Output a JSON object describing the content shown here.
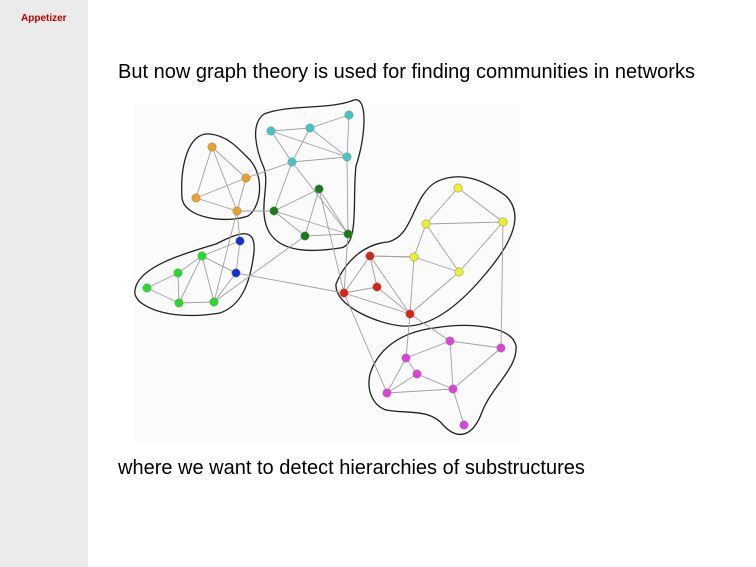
{
  "sidebar": {
    "section_label": "Appetizer"
  },
  "slide": {
    "heading": "But now graph theory is used for finding communities in networks",
    "caption": "where we want to detect hierarchies of substructures"
  },
  "graph": {
    "colors": {
      "orange": "#f0a020",
      "cyan": "#40c8c8",
      "dgreen": "#108010",
      "lgreen": "#20e020",
      "blue": "#1030e0",
      "yellow": "#f0f020",
      "red": "#e02010",
      "magenta": "#e040e0",
      "edge": "#a0a0a0",
      "hull": "#202020"
    },
    "communities": [
      "orange",
      "cyan",
      "dgreen",
      "lgreen-blue",
      "red-yellow",
      "magenta"
    ]
  }
}
